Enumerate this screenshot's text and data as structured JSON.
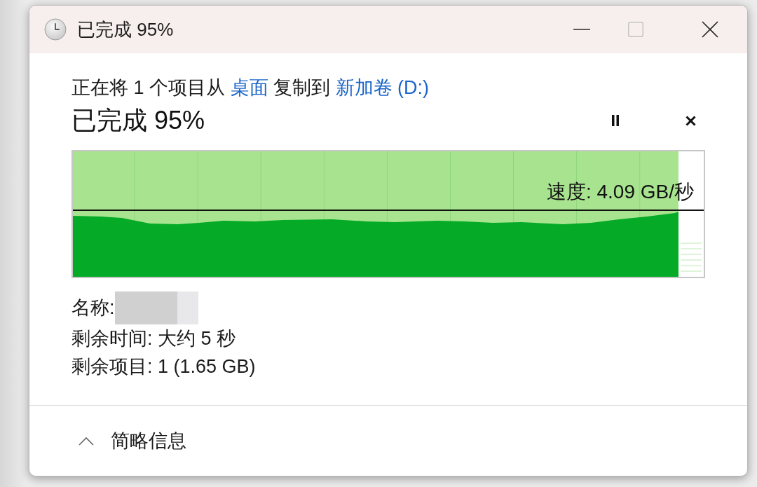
{
  "window": {
    "title": "已完成 95%",
    "controls": [
      {
        "kind": "minimize",
        "disabled": false
      },
      {
        "kind": "maximize",
        "disabled": true
      },
      {
        "kind": "close",
        "disabled": false
      }
    ]
  },
  "description": [
    {
      "kind": "text",
      "text": "正在将 1 个项目从"
    },
    {
      "kind": "link",
      "text": "桌面"
    },
    {
      "kind": "text",
      "text": "复制到"
    },
    {
      "kind": "link",
      "text": "新加卷 (D:)"
    }
  ],
  "status": {
    "text": "已完成 95%",
    "paused": false
  },
  "graph": {
    "level": 0.96,
    "speed": "速度: 4.09 GB/秒"
  },
  "details": [
    {
      "kind": "redacted",
      "text": "名称:"
    },
    {
      "kind": "text",
      "text": "剩余时间: 大约 5 秒"
    },
    {
      "kind": "text",
      "text": "剩余项目: 1 (1.65 GB)"
    }
  ],
  "footer": {
    "label": "简略信息",
    "expanded": true
  }
}
